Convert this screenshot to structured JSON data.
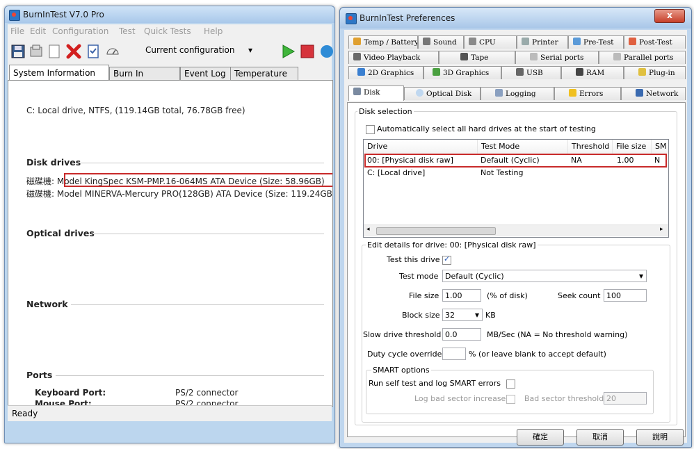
{
  "main_window": {
    "title": "BurnInTest V7.0 Pro",
    "menu": [
      "File",
      "Edit",
      "Configuration",
      "Test",
      "Quick Tests",
      "Help"
    ],
    "config_select": "Current configuration",
    "tabs": [
      "System Information",
      "Burn In Results",
      "Event Log",
      "Temperature"
    ],
    "local_drive_info": "C:  Local drive, NTFS, (119.14GB total, 76.78GB free)",
    "disk_drives_title": "Disk drives",
    "disk_drive_1": "磁碟機: Model KingSpec KSM-PMP.16-064MS ATA Device (Size: 58.96GB)",
    "disk_drive_2": "磁碟機: Model MINERVA-Mercury PRO(128GB) ATA Device (Size: 119.24GB",
    "optical_drives_title": "Optical drives",
    "network_title": "Network",
    "ports_title": "Ports",
    "ports": [
      {
        "name": "Keyboard Port:",
        "value": "PS/2  connector"
      },
      {
        "name": "Mouse Port:",
        "value": "PS/2  connector"
      }
    ],
    "status": "Ready"
  },
  "preferences": {
    "title": "BurnInTest Preferences",
    "close_label": "x",
    "tabs_row1": [
      "Temp / Battery",
      "Sound",
      "CPU",
      "Printer",
      "Pre-Test",
      "Post-Test"
    ],
    "tabs_row2": [
      "Video Playback",
      "Tape",
      "Serial ports",
      "Parallel ports"
    ],
    "tabs_row3": [
      "2D Graphics",
      "3D Graphics",
      "USB",
      "RAM",
      "Plug-in"
    ],
    "tabs_row4": [
      "Disk",
      "Optical Disk",
      "Logging",
      "Errors",
      "Network"
    ],
    "disk_selection_title": "Disk selection",
    "auto_select_label": "Automatically select all hard drives at the start of testing",
    "columns": [
      "Drive",
      "Test Mode",
      "Threshold",
      "File size",
      "SM"
    ],
    "rows": [
      {
        "drive": "00:  [Physical disk raw]",
        "mode": "Default (Cyclic)",
        "threshold": "NA",
        "filesize": "1.00",
        "sm": "N"
      },
      {
        "drive": "C:  [Local drive]",
        "mode": "Not Testing",
        "threshold": "",
        "filesize": "",
        "sm": ""
      }
    ],
    "edit_details_title": "Edit details for drive: 00:  [Physical disk raw]",
    "test_this_drive_label": "Test this drive",
    "test_mode_label": "Test mode",
    "test_mode_value": "Default (Cyclic)",
    "file_size_label": "File size",
    "file_size_value": "1.00",
    "file_size_unit": "(% of disk)",
    "seek_count_label": "Seek count",
    "seek_count_value": "100",
    "block_size_label": "Block size",
    "block_size_value": "32",
    "block_size_unit": "KB",
    "slow_threshold_label": "Slow drive threshold",
    "slow_threshold_value": "0.0",
    "slow_threshold_unit": "MB/Sec  (NA = No threshold warning)",
    "duty_cycle_label": "Duty cycle override",
    "duty_cycle_value": "",
    "duty_cycle_unit": "% (or leave blank to accept default)",
    "smart_title": "SMART options",
    "smart_log_label": "Run self test and log SMART errors",
    "log_bad_label": "Log bad sector increase",
    "bad_threshold_label": "Bad sector threshold",
    "bad_threshold_value": "20",
    "buttons": {
      "ok": "確定",
      "cancel": "取消",
      "help": "說明"
    }
  }
}
